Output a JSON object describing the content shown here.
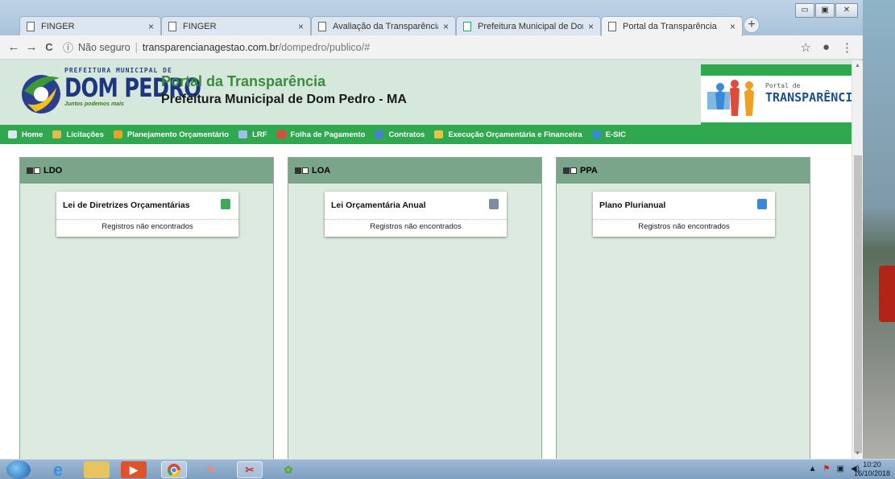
{
  "browser": {
    "tabs": [
      {
        "title": "FINGER"
      },
      {
        "title": "FINGER"
      },
      {
        "title": "Avaliação da Transparência do"
      },
      {
        "title": "Prefeitura Municipal de Dom P"
      },
      {
        "title": "Portal da Transparência"
      }
    ],
    "close_glyph": "×",
    "new_tab_glyph": "+",
    "window_controls": {
      "minimize": "▭",
      "maximize": "▣",
      "close": "✕"
    },
    "nav": {
      "back": "←",
      "forward": "→",
      "reload": "C"
    },
    "address": {
      "security_label": "Não seguro",
      "domain": "transparencianagestao.com.br",
      "path": "/dompedro/publico/#"
    },
    "star_glyph": "☆",
    "profile_glyph": "●",
    "menu_glyph": "⋮"
  },
  "site": {
    "logo": {
      "small": "PREFEITURA MUNICIPAL DE",
      "big": "DOM PEDRO",
      "slogan": "Juntos podemos mais"
    },
    "title": "Portal da Transparência",
    "subtitle": "Prefeitura Municipal de Dom Pedro - MA",
    "badge": {
      "small": "Portal de",
      "big": "TRANSPARÊNCIA"
    }
  },
  "menu": [
    {
      "label": "Home",
      "color": "#dfe7f0"
    },
    {
      "label": "Licitações",
      "color": "#e8b84a"
    },
    {
      "label": "Planejamento Orçamentário",
      "color": "#f0a020"
    },
    {
      "label": "LRF",
      "color": "#9ec0e8"
    },
    {
      "label": "Folha de Pagamento",
      "color": "#e04a3a"
    },
    {
      "label": "Contratos",
      "color": "#4a7fd0"
    },
    {
      "label": "Execução Orçamentária e Financeira",
      "color": "#f0c040"
    },
    {
      "label": "E-SIC",
      "color": "#3a88d8"
    }
  ],
  "panels": [
    {
      "header": "LDO",
      "card_title": "Lei de Diretrizes Orçamentárias",
      "message": "Registros não encontrados",
      "icon_color": "#3fa85a"
    },
    {
      "header": "LOA",
      "card_title": "Lei Orçamentária Anual",
      "message": "Registros não encontrados",
      "icon_color": "#7d8ca0"
    },
    {
      "header": "PPA",
      "card_title": "Plano Plurianual",
      "message": "Registros não encontrados",
      "icon_color": "#3a88d8"
    }
  ],
  "taskbar": {
    "time": "10:20",
    "date": "16/10/2018"
  }
}
